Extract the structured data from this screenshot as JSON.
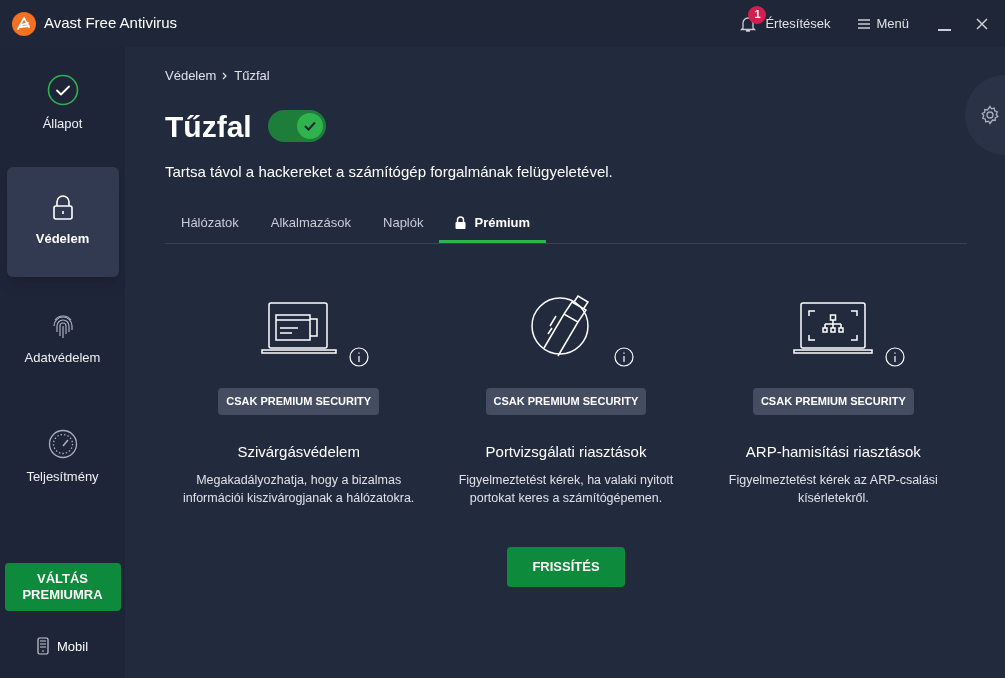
{
  "window": {
    "title": "Avast Free Antivirus"
  },
  "header": {
    "notifications": {
      "label": "Értesítések",
      "count": "1"
    },
    "menu": "Menü"
  },
  "sidebar": {
    "items": [
      {
        "label": "Állapot",
        "selected": false
      },
      {
        "label": "Védelem",
        "selected": true
      },
      {
        "label": "Adatvédelem",
        "selected": false
      },
      {
        "label": "Teljesítmény",
        "selected": false
      }
    ],
    "upgrade_button": "VÁLTÁS PREMIUMRA",
    "mobile": "Mobil"
  },
  "breadcrumb": [
    "Védelem",
    "Tűzfal"
  ],
  "page": {
    "title": "Tűzfal",
    "enabled": true,
    "subtitle": "Tartsa távol a hackereket a számítógép forgalmának felügyeletével."
  },
  "tabs": [
    {
      "label": "Hálózatok",
      "selected": false,
      "locked": false
    },
    {
      "label": "Alkalmazások",
      "selected": false,
      "locked": false
    },
    {
      "label": "Naplók",
      "selected": false,
      "locked": false
    },
    {
      "label": "Prémium",
      "selected": true,
      "locked": true
    }
  ],
  "features": [
    {
      "badge": "CSAK PREMIUM SECURITY",
      "title": "Szivárgásvédelem",
      "description": "Megakadályozhatja, hogy a bizalmas információi kiszivárogjanak a hálózatokra."
    },
    {
      "badge": "CSAK PREMIUM SECURITY",
      "title": "Portvizsgálati riasztások",
      "description": "Figyelmeztetést kérek, ha valaki nyitott portokat keres a számítógépemen."
    },
    {
      "badge": "CSAK PREMIUM SECURITY",
      "title": "ARP-hamisítási riasztások",
      "description": "Figyelmeztetést kérek az ARP-csalási kísérletekről."
    }
  ],
  "upgrade_button": "FRISSÍTÉS"
}
